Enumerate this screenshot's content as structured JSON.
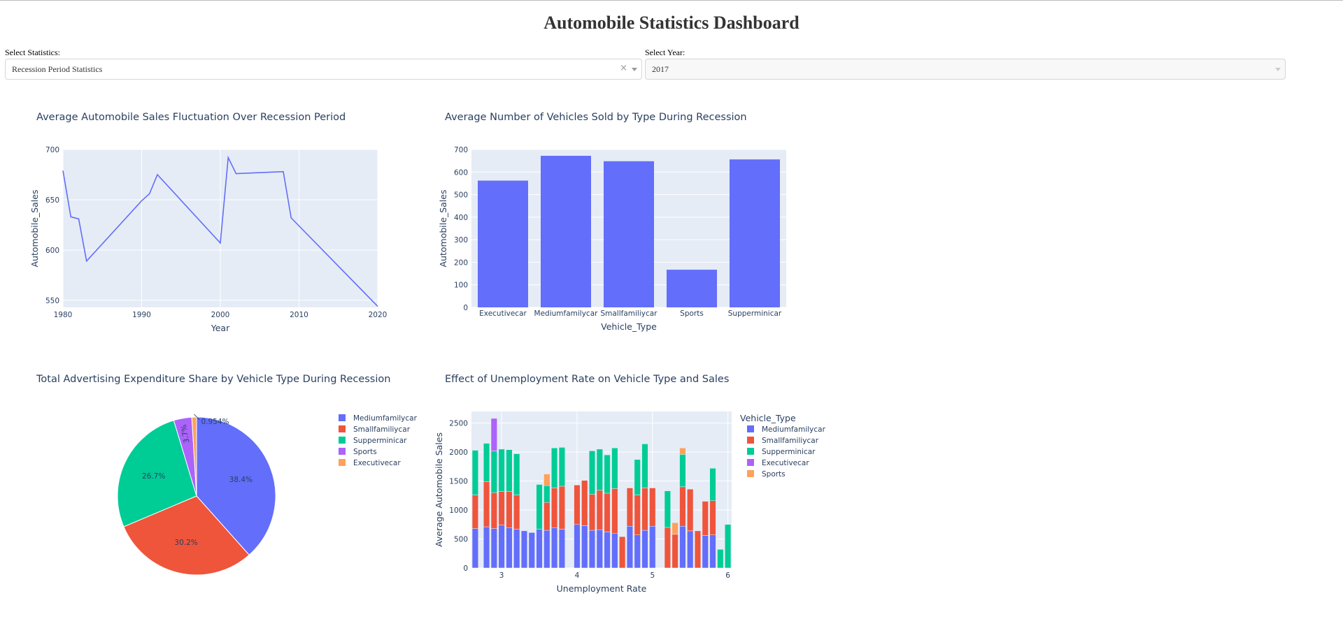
{
  "page": {
    "title": "Automobile Statistics Dashboard"
  },
  "controls": {
    "statistics": {
      "label": "Select Statistics:",
      "value": "Recession Period Statistics",
      "clear_icon": "×"
    },
    "year": {
      "label": "Select Year:",
      "value": "2017"
    }
  },
  "colors": {
    "blue": "#636efa",
    "red": "#ef553b",
    "green": "#00cc96",
    "purple": "#ab63fa",
    "orange": "#ffa15a",
    "plot_bg": "#e5ecf6"
  },
  "chart_data": [
    {
      "type": "line",
      "title": "Average Automobile Sales Fluctuation Over Recession Period",
      "xlabel": "Year",
      "ylabel": "Automobile_Sales",
      "xlim": [
        1980,
        2020
      ],
      "ylim": [
        543,
        700
      ],
      "xticks": [
        1980,
        1990,
        2000,
        2010,
        2020
      ],
      "yticks": [
        550,
        600,
        650,
        700
      ],
      "x": [
        1980,
        1981,
        1982,
        1983,
        1990,
        1991,
        1992,
        2000,
        2001,
        2002,
        2008,
        2009,
        2020
      ],
      "y": [
        679,
        633,
        631,
        589,
        649,
        656,
        675,
        607,
        692,
        676,
        678,
        632,
        544
      ],
      "color": "#636efa"
    },
    {
      "type": "bar",
      "title": "Average Number of Vehicles Sold by Type During Recession",
      "xlabel": "Vehicle_Type",
      "ylabel": "Automobile_Sales",
      "ylim": [
        0,
        700
      ],
      "yticks": [
        0,
        100,
        200,
        300,
        400,
        500,
        600,
        700
      ],
      "categories": [
        "Executivecar",
        "Mediumfamilycar",
        "Smallfamiliycar",
        "Sports",
        "Supperminicar"
      ],
      "values": [
        562,
        672,
        648,
        167,
        656
      ],
      "color": "#636efa"
    },
    {
      "type": "pie",
      "title": "Total Advertising Expenditure Share by Vehicle Type During Recession",
      "labels": [
        "Mediumfamilycar",
        "Smallfamiliycar",
        "Supperminicar",
        "Sports",
        "Executivecar"
      ],
      "values": [
        38.4,
        30.2,
        26.7,
        3.7,
        0.954
      ],
      "text_labels": [
        "38.4%",
        "30.2%",
        "26.7%",
        "3.7%",
        "0.954%"
      ],
      "colors": [
        "#636efa",
        "#ef553b",
        "#00cc96",
        "#ab63fa",
        "#ffa15a"
      ],
      "legend_position": "right"
    },
    {
      "type": "bar",
      "stacked": true,
      "title": "Effect of Unemployment Rate on Vehicle Type and Sales",
      "xlabel": "Unemployment Rate",
      "ylabel": "Average Automobile Sales",
      "legend_title": "Vehicle_Type",
      "xlim": [
        2.6,
        6.05
      ],
      "ylim": [
        0,
        2700
      ],
      "xticks": [
        3,
        4,
        5,
        6
      ],
      "yticks": [
        0,
        500,
        1000,
        1500,
        2000,
        2500
      ],
      "series": [
        {
          "name": "Mediumfamilycar",
          "color": "#636efa",
          "points": [
            [
              2.65,
              680
            ],
            [
              2.8,
              710
            ],
            [
              2.9,
              680
            ],
            [
              3.0,
              740
            ],
            [
              3.1,
              690
            ],
            [
              3.2,
              670
            ],
            [
              3.3,
              640
            ],
            [
              3.4,
              610
            ],
            [
              3.5,
              670
            ],
            [
              3.6,
              650
            ],
            [
              3.7,
              690
            ],
            [
              3.8,
              670
            ],
            [
              4.0,
              750
            ],
            [
              4.1,
              730
            ],
            [
              4.2,
              650
            ],
            [
              4.3,
              660
            ],
            [
              4.4,
              620
            ],
            [
              4.5,
              600
            ],
            [
              4.7,
              720
            ],
            [
              4.8,
              570
            ],
            [
              4.9,
              650
            ],
            [
              5.0,
              720
            ],
            [
              5.4,
              720
            ],
            [
              5.5,
              640
            ],
            [
              5.7,
              560
            ],
            [
              5.8,
              570
            ]
          ]
        },
        {
          "name": "Smallfamiliycar",
          "color": "#ef553b",
          "points": [
            [
              2.65,
              580
            ],
            [
              2.8,
              780
            ],
            [
              2.9,
              620
            ],
            [
              3.0,
              580
            ],
            [
              3.1,
              630
            ],
            [
              3.2,
              590
            ],
            [
              3.6,
              480
            ],
            [
              3.7,
              690
            ],
            [
              3.8,
              740
            ],
            [
              4.0,
              680
            ],
            [
              4.1,
              780
            ],
            [
              4.2,
              620
            ],
            [
              4.3,
              680
            ],
            [
              4.4,
              670
            ],
            [
              4.5,
              770
            ],
            [
              4.6,
              540
            ],
            [
              4.7,
              660
            ],
            [
              4.8,
              690
            ],
            [
              4.9,
              730
            ],
            [
              5.0,
              660
            ],
            [
              5.2,
              700
            ],
            [
              5.3,
              580
            ],
            [
              5.4,
              680
            ],
            [
              5.5,
              720
            ],
            [
              5.6,
              640
            ],
            [
              5.7,
              590
            ],
            [
              5.8,
              590
            ]
          ]
        },
        {
          "name": "Supperminicar",
          "color": "#00cc96",
          "points": [
            [
              2.65,
              770
            ],
            [
              2.8,
              660
            ],
            [
              2.9,
              720
            ],
            [
              3.0,
              730
            ],
            [
              3.1,
              720
            ],
            [
              3.2,
              710
            ],
            [
              3.5,
              770
            ],
            [
              3.6,
              290
            ],
            [
              3.7,
              690
            ],
            [
              3.8,
              670
            ],
            [
              4.2,
              750
            ],
            [
              4.3,
              710
            ],
            [
              4.4,
              660
            ],
            [
              4.5,
              700
            ],
            [
              4.8,
              610
            ],
            [
              4.9,
              760
            ],
            [
              5.2,
              630
            ],
            [
              5.4,
              560
            ],
            [
              5.8,
              560
            ],
            [
              5.9,
              320
            ],
            [
              6.0,
              750
            ]
          ]
        },
        {
          "name": "Executivecar",
          "color": "#ab63fa",
          "points": [
            [
              2.9,
              560
            ]
          ]
        },
        {
          "name": "Sports",
          "color": "#ffa15a",
          "points": [
            [
              3.6,
              200
            ],
            [
              5.3,
              200
            ],
            [
              5.4,
              110
            ]
          ]
        }
      ]
    }
  ]
}
